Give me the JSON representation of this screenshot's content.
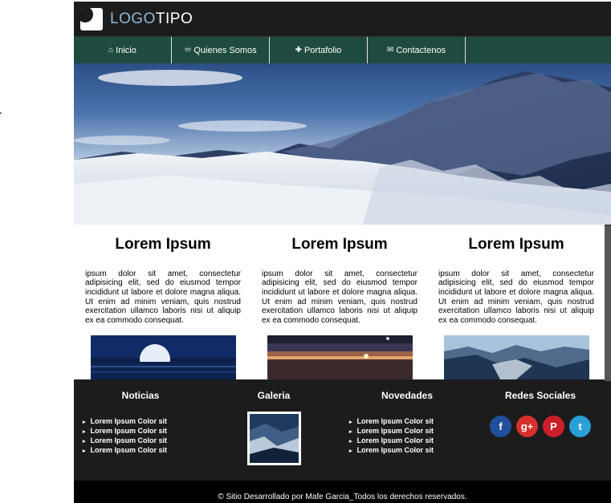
{
  "logo": {
    "part_a": "LOGO",
    "part_b": "TIPO"
  },
  "nav": [
    {
      "label": "Inicio",
      "icon": "home-icon",
      "glyph": "⌂"
    },
    {
      "label": "Quienes Somos",
      "icon": "handshake-icon",
      "glyph": "♾"
    },
    {
      "label": "Portafolio",
      "icon": "puzzle-icon",
      "glyph": "✚"
    },
    {
      "label": "Contactenos",
      "icon": "envelope-icon",
      "glyph": "✉"
    }
  ],
  "columns": [
    {
      "title": "Lorem Ipsum",
      "text": "ipsum dolor sit amet, consectetur adipisicing elit, sed do eiusmod tempor incididunt ut labore et dolore magna aliqua. Ut enim ad minim veniam, quis nostrud exercitation ullamco laboris nisi ut aliquip ex ea commodo consequat."
    },
    {
      "title": "Lorem Ipsum",
      "text": "ipsum dolor sit amet, consectetur adipisicing elit, sed do eiusmod tempor incididunt ut labore et dolore magna aliqua. Ut enim ad minim veniam, quis nostrud exercitation ullamco laboris nisi ut aliquip ex ea commodo consequat."
    },
    {
      "title": "Lorem Ipsum",
      "text": "ipsum dolor sit amet, consectetur adipisicing elit, sed do eiusmod tempor incididunt ut labore et dolore magna aliqua. Ut enim ad minim veniam, quis nostrud exercitation ullamco laboris nisi ut aliquip ex ea commodo consequat."
    }
  ],
  "footer": {
    "noticias": {
      "title": "Noticias",
      "items": [
        "Lorem Ipsum Color sit",
        "Lorem Ipsum Color sit",
        "Lorem Ipsum Color sit",
        "Lorem Ipsum Color sit"
      ]
    },
    "galeria": {
      "title": "Galeria"
    },
    "novedades": {
      "title": "Novedades",
      "items": [
        "Lorem Ipsum Color sit",
        "Lorem Ipsum Color sit",
        "Lorem Ipsum Color sit",
        "Lorem Ipsum Color sit"
      ]
    },
    "redes": {
      "title": "Redes Sociales",
      "icons": [
        {
          "name": "facebook-icon",
          "glyph": "f",
          "color": "#1f4f9a"
        },
        {
          "name": "google-plus-icon",
          "glyph": "g+",
          "color": "#d7302a"
        },
        {
          "name": "pinterest-icon",
          "glyph": "P",
          "color": "#cc1e2b"
        },
        {
          "name": "twitter-icon",
          "glyph": "t",
          "color": "#2a9fd8"
        }
      ]
    }
  },
  "copyright": "© Sitio Desarrollado por Mafe Garcia_Todos los derechos reservados.",
  "colors": {
    "nav_bg": "#1f4a3f",
    "page_bg": "#1c1c1c",
    "logo_accent": "#8fb7d8"
  }
}
